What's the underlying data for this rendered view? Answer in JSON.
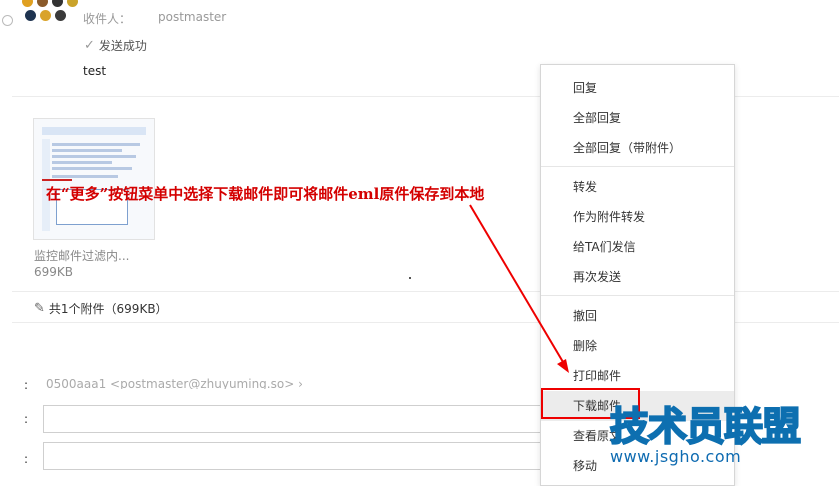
{
  "header": {
    "recipient_label": "收件人：",
    "recipient_value": "postmaster",
    "sent_status": "发送成功",
    "body_text": "test"
  },
  "attachment": {
    "name": "监控邮件过滤内...",
    "size": "699KB",
    "summary": "共1个附件（699KB）"
  },
  "annotation": "在“更多”按钮菜单中选择下载邮件即可将邮件eml原件保存到本地",
  "compose": {
    "faded_line": "0500aaa1 <postmaster@zhuyuming.so> ›",
    "colon": ":"
  },
  "menu": {
    "items": [
      {
        "label": "回复"
      },
      {
        "label": "全部回复"
      },
      {
        "label": "全部回复（带附件）"
      },
      {
        "label": "转发"
      },
      {
        "label": "作为附件转发"
      },
      {
        "label": "给TA们发信"
      },
      {
        "label": "再次发送"
      },
      {
        "label": "撤回"
      },
      {
        "label": "删除"
      },
      {
        "label": "打印邮件"
      },
      {
        "label": "下载邮件"
      },
      {
        "label": "查看原文"
      },
      {
        "label": "移动"
      }
    ]
  },
  "watermark": {
    "title": "技术员联盟",
    "url": "www.jsgho.com"
  },
  "colors": {
    "annotation": "#d40000",
    "highlight_box": "#ee0000",
    "watermark": "#1aa3e6"
  }
}
